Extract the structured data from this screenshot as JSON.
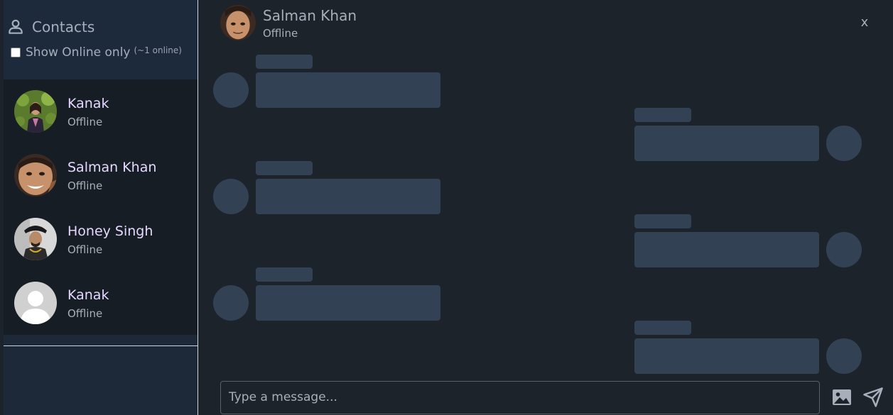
{
  "sidebar": {
    "heading": "Contacts",
    "heading_icon": "user-icon",
    "online_filter": {
      "label": "Show Online only",
      "count": "(~1 online)",
      "checked": false
    },
    "contacts": [
      {
        "name": "Kanak",
        "status": "Offline",
        "avatar": "photo"
      },
      {
        "name": "Salman Khan",
        "status": "Offline",
        "avatar": "photo"
      },
      {
        "name": "Honey Singh",
        "status": "Offline",
        "avatar": "photo"
      },
      {
        "name": "Kanak",
        "status": "Offline",
        "avatar": "default-avatar-icon"
      }
    ]
  },
  "chat": {
    "header": {
      "name": "Salman Khan",
      "status": "Offline"
    },
    "close_label": "x",
    "composer": {
      "placeholder": "Type a message...",
      "image_icon": "image-icon",
      "send_icon": "send-icon"
    }
  },
  "colors": {
    "sidebar_bg": "#1d2938",
    "list_bg": "#171d24",
    "chat_bg": "#1d232a",
    "skeleton": "#334155",
    "name_accent": "#e5d7ff",
    "muted_text": "#a7afbb"
  }
}
